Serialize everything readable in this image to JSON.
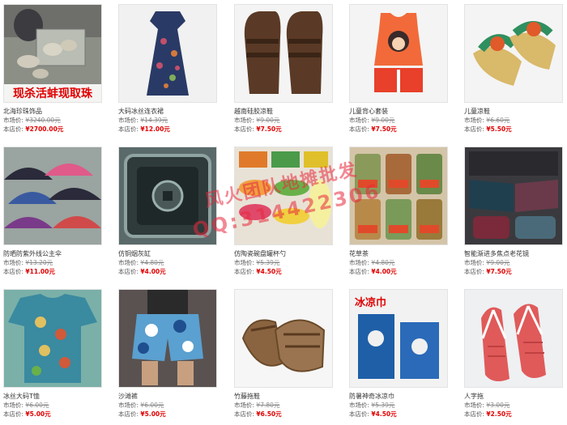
{
  "labels": {
    "market": "市场价:",
    "our": "本店价:"
  },
  "watermark": {
    "line1": "风火团队地摊批发",
    "line2": "QQ:314422306"
  },
  "products": [
    {
      "name": "北海珍珠饰品",
      "market": "¥3240.00元",
      "price": "¥2700.00元",
      "icon": "pearl-market-photo",
      "banner": "现杀活蚌现取珠"
    },
    {
      "name": "大码冰丝连衣裙",
      "market": "¥14.39元",
      "price": "¥12.00元",
      "icon": "floral-dress-photo"
    },
    {
      "name": "越南硅胶凉鞋",
      "market": "¥9.00元",
      "price": "¥7.50元",
      "icon": "brown-sandals-photo"
    },
    {
      "name": "儿童背心套装",
      "market": "¥9.00元",
      "price": "¥7.50元",
      "icon": "kids-vest-set-photo"
    },
    {
      "name": "儿童凉鞋",
      "market": "¥6.60元",
      "price": "¥5.50元",
      "icon": "kids-sandals-photo"
    },
    {
      "name": "防晒防紫外线公主伞",
      "market": "¥13.20元",
      "price": "¥11.00元",
      "icon": "umbrellas-photo"
    },
    {
      "name": "仿铜烟灰缸",
      "market": "¥4.80元",
      "price": "¥4.00元",
      "icon": "bronze-ashtray-photo"
    },
    {
      "name": "仿陶瓷碗盘罐杯勺",
      "market": "¥5.39元",
      "price": "¥4.50元",
      "icon": "plastic-bowls-photo"
    },
    {
      "name": "花草茶",
      "market": "¥4.80元",
      "price": "¥4.00元",
      "icon": "tea-jars-photo"
    },
    {
      "name": "智能渐进多焦点老花镜",
      "market": "¥9.00元",
      "price": "¥7.50元",
      "icon": "glasses-cases-photo"
    },
    {
      "name": "冰丝大码T恤",
      "market": "¥6.00元",
      "price": "¥5.00元",
      "icon": "floral-tshirt-photo"
    },
    {
      "name": "沙滩裤",
      "market": "¥6.00元",
      "price": "¥5.00元",
      "icon": "beach-shorts-photo"
    },
    {
      "name": "竹藤拖鞋",
      "market": "¥7.80元",
      "price": "¥6.50元",
      "icon": "rattan-slippers-photo"
    },
    {
      "name": "防暑神奇冰凉巾",
      "market": "¥5.39元",
      "price": "¥4.50元",
      "icon": "cooling-towel-photo",
      "banner": "冰凉巾"
    },
    {
      "name": "人字拖",
      "market": "¥3.00元",
      "price": "¥2.50元",
      "icon": "flip-flops-photo"
    }
  ]
}
